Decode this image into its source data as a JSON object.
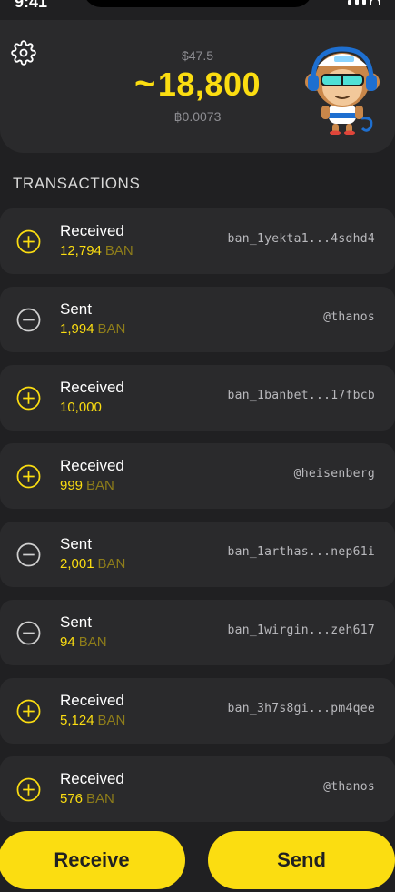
{
  "status": {
    "time": "9:41"
  },
  "header": {
    "fiat_balance": "$47.5",
    "balance_prefix": "~",
    "balance": "18,800",
    "btc_balance": "฿0.0073"
  },
  "transactions_title": "TRANSACTIONS",
  "transactions": [
    {
      "type": "Received",
      "amount": "12,794",
      "unit": "BAN",
      "account": "ban_1yekta1...4sdhd4",
      "icon": "plus-circle-icon"
    },
    {
      "type": "Sent",
      "amount": "1,994",
      "unit": "BAN",
      "account": "@thanos",
      "icon": "minus-circle-icon"
    },
    {
      "type": "Received",
      "amount": "10,000",
      "unit": "",
      "account": "ban_1banbet...17fbcb",
      "icon": "plus-circle-icon"
    },
    {
      "type": "Received",
      "amount": "999",
      "unit": "BAN",
      "account": "@heisenberg",
      "icon": "plus-circle-icon"
    },
    {
      "type": "Sent",
      "amount": "2,001",
      "unit": "BAN",
      "account": "ban_1arthas...nep61i",
      "icon": "minus-circle-icon"
    },
    {
      "type": "Sent",
      "amount": "94",
      "unit": "BAN",
      "account": "ban_1wirgin...zeh617",
      "icon": "minus-circle-icon"
    },
    {
      "type": "Received",
      "amount": "5,124",
      "unit": "BAN",
      "account": "ban_3h7s8gi...pm4qee",
      "icon": "plus-circle-icon"
    },
    {
      "type": "Received",
      "amount": "576",
      "unit": "BAN",
      "account": "@thanos",
      "icon": "plus-circle-icon"
    }
  ],
  "buttons": {
    "receive": "Receive",
    "send": "Send"
  },
  "colors": {
    "accent": "#fbdd11",
    "background": "#202022",
    "card": "#2a2a2c",
    "muted": "#8e8e93"
  }
}
